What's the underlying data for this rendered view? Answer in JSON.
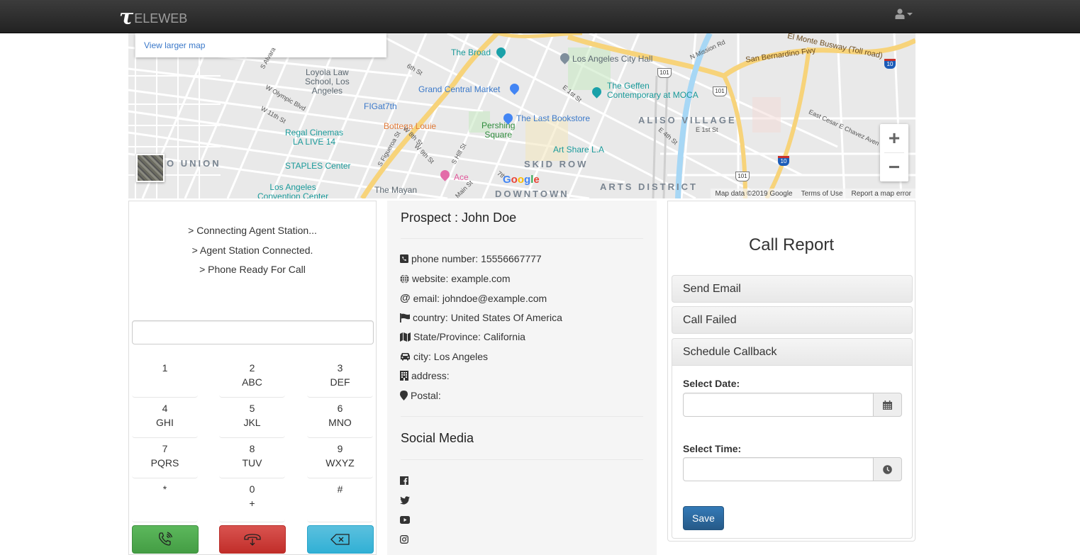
{
  "navbar": {
    "brand_logo": "τ",
    "brand_text": "ELEWEB",
    "user_icon": "user-icon"
  },
  "map": {
    "view_larger_map": "View larger map",
    "zoom_in": "+",
    "zoom_out": "−",
    "footer": {
      "map_data": "Map data ©2019 Google",
      "terms": "Terms of Use",
      "report": "Report a map error"
    },
    "labels": {
      "broad": "The Broad",
      "city_hall": "Los Angeles City Hall",
      "loyola": "Loyola Law\nSchool, Los\nAngeles",
      "grand_central": "Grand Central Market",
      "geffen": "The Geffen\nContemporary at MOCA",
      "figat7th": "FIGat7th",
      "bottega": "Bottega Louie",
      "pershing": "Pershing\nSquare",
      "last_bookstore": "The Last Bookstore",
      "aliso": "ALISO VILLAGE",
      "regal": "Regal Cinemas\nLA LIVE 14",
      "art_share": "Art Share L.A",
      "union": "O UNION",
      "staples": "STAPLES Center",
      "skid_row": "SKID ROW",
      "ace": "Ace",
      "google": "Google",
      "arts_district": "ARTS DISTRICT",
      "la_convention": "Los Angeles\nConvention Center",
      "mayan": "The Mayan",
      "downtown": "DOWNTOWN",
      "san_bernardino": "San Bernardino Fwy",
      "el_monte": "El Monte Busway (Toll road)",
      "n_mission": "N Mission Rd",
      "cesar_chavez": "East Cesar E Chavez Aven",
      "e_1st_st_a": "E 1st St",
      "e_1st_st_b": "E 1st St",
      "e_4th_st": "E 4th St",
      "w_olympic": "W Olympic Blvd",
      "w_11th": "W 11th St",
      "sixth_st": "6th St",
      "s_alvarado": "S Alvara",
      "s_figueroa": "S Figueroa St",
      "w_8th": "W 8th St",
      "w_9th": "W 9th St",
      "s_hill": "S Hill St",
      "main_st": "Main St",
      "seventh": "7th",
      "hwy_101": "101",
      "hwy_10": "10"
    }
  },
  "phone": {
    "status_lines": [
      "> Connecting Agent Station...",
      "> Agent Station Connected.",
      "> Phone Ready For Call"
    ],
    "dial_value": "",
    "keys": [
      {
        "digit": "1",
        "letters": ""
      },
      {
        "digit": "2",
        "letters": "ABC"
      },
      {
        "digit": "3",
        "letters": "DEF"
      },
      {
        "digit": "4",
        "letters": "GHI"
      },
      {
        "digit": "5",
        "letters": "JKL"
      },
      {
        "digit": "6",
        "letters": "MNO"
      },
      {
        "digit": "7",
        "letters": "PQRS"
      },
      {
        "digit": "8",
        "letters": "TUV"
      },
      {
        "digit": "9",
        "letters": "WXYZ"
      },
      {
        "digit": "*",
        "letters": ""
      },
      {
        "digit": "0",
        "letters": "+"
      },
      {
        "digit": "#",
        "letters": ""
      }
    ],
    "buttons": {
      "call": "phone-call-icon",
      "hangup": "hang-up-icon",
      "backspace": "backspace-icon"
    },
    "colors": {
      "call": "#5cb85c",
      "hangup": "#d9534f",
      "backspace": "#5bc0de"
    }
  },
  "prospect": {
    "title": "Prospect : John Doe",
    "fields": [
      {
        "icon": "phone-square-icon",
        "text": "phone number: 15556667777"
      },
      {
        "icon": "globe-icon",
        "text": "website: example.com"
      },
      {
        "icon": "at-icon",
        "text": "email: johndoe@example.com"
      },
      {
        "icon": "flag-icon",
        "text": "country: United States Of America"
      },
      {
        "icon": "map-icon",
        "text": "State/Province: California"
      },
      {
        "icon": "car-icon",
        "text": "city: Los Angeles"
      },
      {
        "icon": "building-icon",
        "text": "address:"
      },
      {
        "icon": "map-marker-icon",
        "text": "Postal:"
      }
    ],
    "social_title": "Social Media",
    "social": [
      "facebook-icon",
      "twitter-icon",
      "youtube-icon",
      "instagram-icon"
    ]
  },
  "report": {
    "title": "Call Report",
    "sections": [
      "Send Email",
      "Call Failed",
      "Schedule Callback"
    ],
    "date_label": "Select Date:",
    "date_value": "",
    "time_label": "Select Time:",
    "time_value": "",
    "save_label": "Save"
  }
}
